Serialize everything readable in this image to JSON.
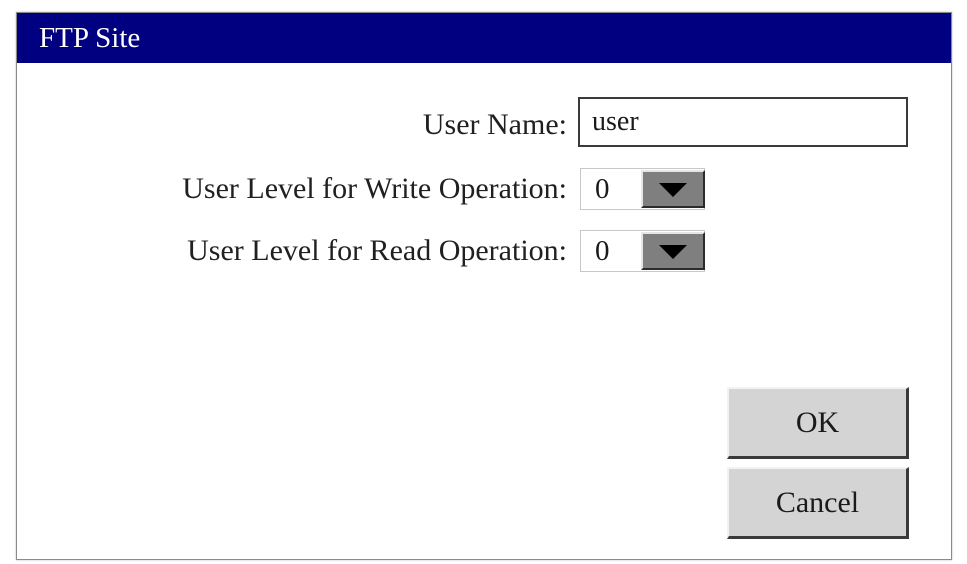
{
  "window": {
    "title": "FTP Site",
    "title_bar_color": "#000080"
  },
  "form": {
    "user_name": {
      "label": "User Name:",
      "value": "user"
    },
    "write_level": {
      "label": "User Level for Write Operation:",
      "value": "0",
      "button_icon": "chevron-down-icon"
    },
    "read_level": {
      "label": "User Level for Read Operation:",
      "value": "0",
      "button_icon": "chevron-down-icon"
    }
  },
  "buttons": {
    "ok_label": "OK",
    "cancel_label": "Cancel"
  }
}
